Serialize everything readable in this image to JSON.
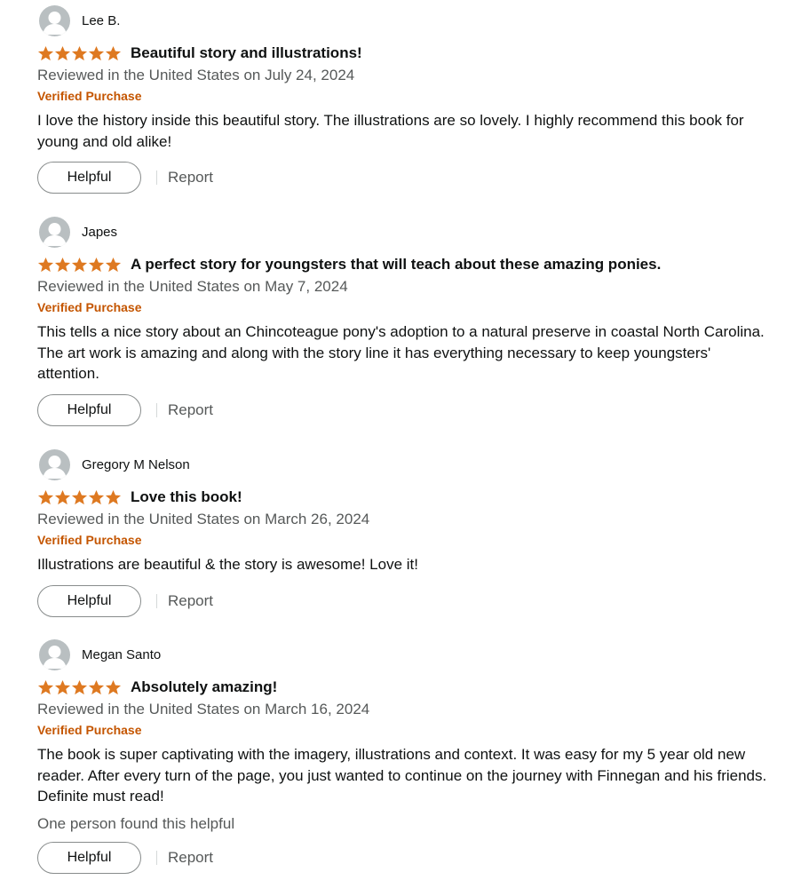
{
  "colors": {
    "star": "#de7921",
    "verified": "#c45500",
    "muted": "#565959"
  },
  "icons": {
    "avatar": "default-profile-icon",
    "star": "star-icon"
  },
  "actions": {
    "helpful_label": "Helpful",
    "report_label": "Report"
  },
  "reviews": [
    {
      "name": "Lee B.",
      "rating": 5,
      "title": "Beautiful story and illustrations!",
      "date": "Reviewed in the United States on July 24, 2024",
      "verified": "Verified Purchase",
      "body": "I love the history inside this beautiful story. The illustrations are so lovely. I highly recommend this book for young and old alike!"
    },
    {
      "name": "Japes",
      "rating": 5,
      "title": "A perfect story for youngsters that will teach about these amazing ponies.",
      "date": "Reviewed in the United States on May 7, 2024",
      "verified": "Verified Purchase",
      "body": "This tells a nice story about an Chincoteague pony's adoption to a natural preserve in coastal North Carolina. The art work is amazing and along with the story line it has everything necessary to keep youngsters' attention."
    },
    {
      "name": "Gregory M Nelson",
      "rating": 5,
      "title": "Love this book!",
      "date": "Reviewed in the United States on March 26, 2024",
      "verified": "Verified Purchase",
      "body": "Illustrations are beautiful & the story is awesome! Love it!"
    },
    {
      "name": "Megan Santo",
      "rating": 5,
      "title": "Absolutely amazing!",
      "date": "Reviewed in the United States on March 16, 2024",
      "verified": "Verified Purchase",
      "body": "The book is super captivating with the imagery, illustrations and context. It was easy for my 5 year old new reader. After every turn of the page, you just wanted to continue on the journey with Finnegan and his friends. Definite must read!",
      "helpful_count": "One person found this helpful"
    }
  ]
}
